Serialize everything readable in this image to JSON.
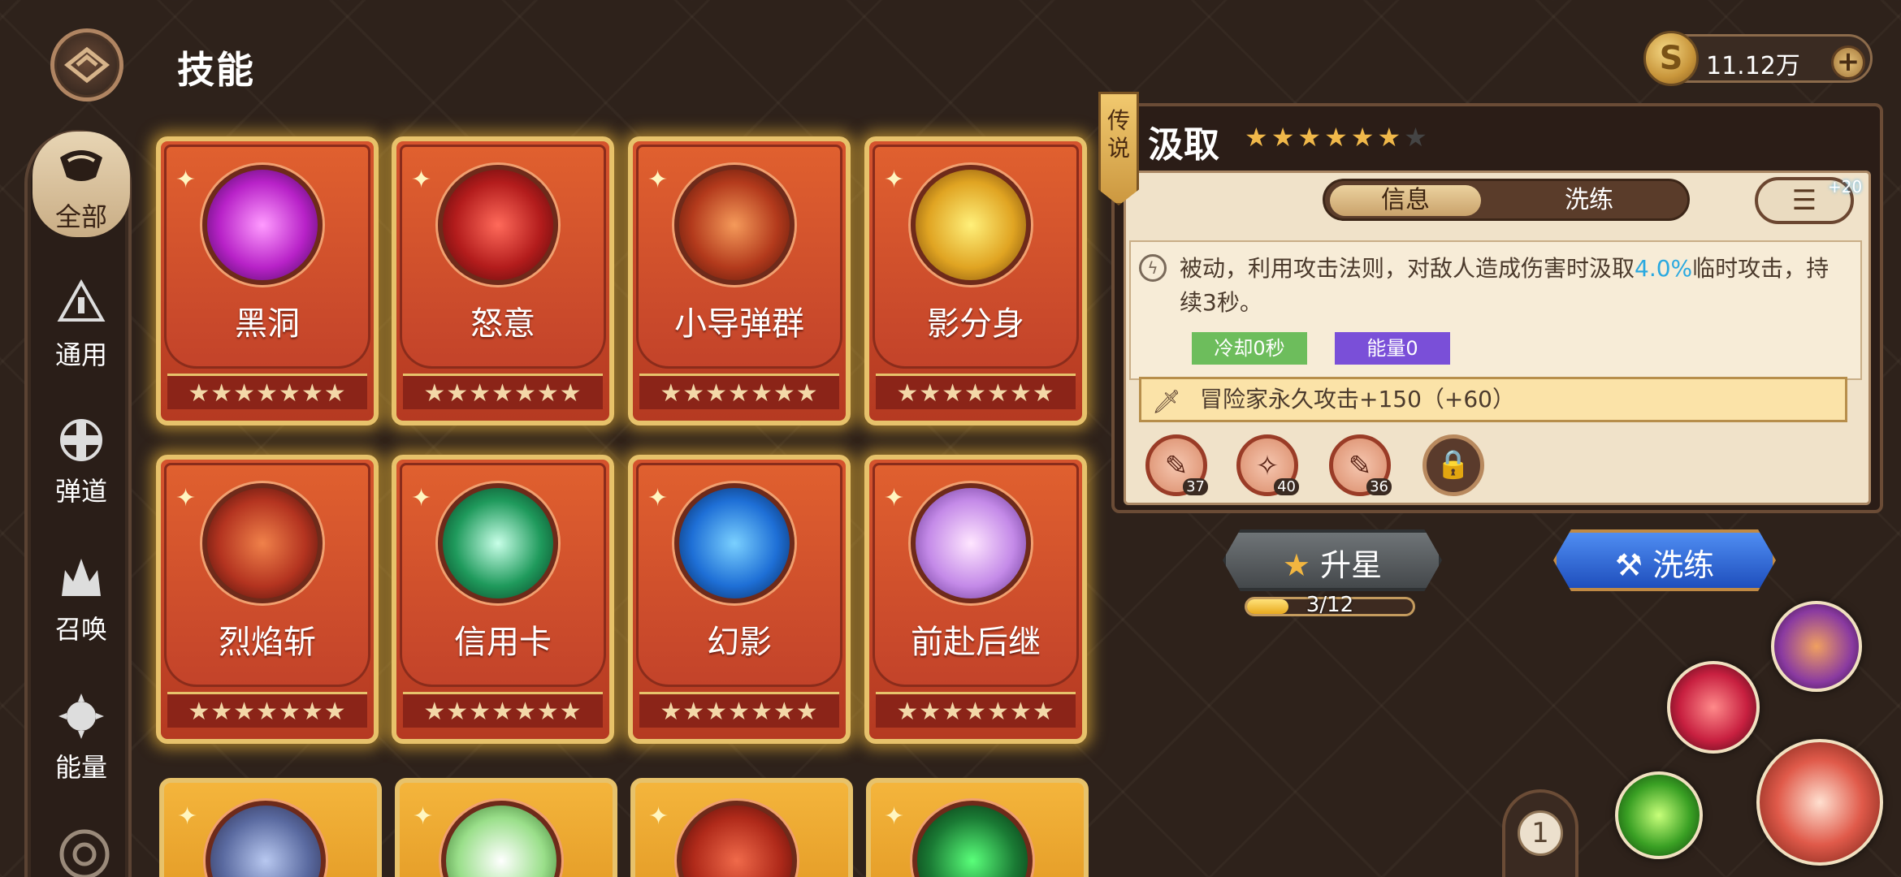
{
  "header": {
    "title": "技能",
    "currency_value": "11.12万",
    "currency_symbol": "S",
    "add_label": "+"
  },
  "sidebar": {
    "items": [
      {
        "label": "全部",
        "active": true
      },
      {
        "label": "通用"
      },
      {
        "label": "弹道"
      },
      {
        "label": "召唤"
      },
      {
        "label": "能量"
      }
    ]
  },
  "cards": [
    {
      "name": "黑洞",
      "stars": "★★★★★★★"
    },
    {
      "name": "怒意",
      "stars": "★★★★★★★"
    },
    {
      "name": "小导弹群",
      "stars": "★★★★★★★"
    },
    {
      "name": "影分身",
      "stars": "★★★★★★★"
    },
    {
      "name": "烈焰斩",
      "stars": "★★★★★★★"
    },
    {
      "name": "信用卡",
      "stars": "★★★★★★★"
    },
    {
      "name": "幻影",
      "stars": "★★★★★★★"
    },
    {
      "name": "前赴后继",
      "stars": "★★★★★★★"
    }
  ],
  "detail": {
    "rarity_tag": "传说",
    "name": "汲取",
    "stars_filled": "★★★★★★",
    "stars_empty": "★",
    "tabs": {
      "info": "信息",
      "refine": "洗练"
    },
    "list_badge": "+20",
    "desc_pre": "被动，利用攻击法则，对敌人造成伤害时汲取",
    "desc_highlight": "4.0%",
    "desc_post": "临时攻击，持续3秒。",
    "cooldown": "冷却0秒",
    "energy": "能量0",
    "bonus": "冒险家永久攻击+150（+60）",
    "sub_levels": [
      "37",
      "40",
      "36"
    ]
  },
  "actions": {
    "upstar_label": "升星",
    "progress_text": "3/12",
    "progress": {
      "current": 3,
      "max": 12
    },
    "refine_label": "洗练"
  },
  "page_indicator": "1",
  "colors": {
    "accent_gold": "#e7c26b",
    "card_red": "#c3432a",
    "highlight_blue": "#2aa9e0",
    "refine_blue": "#2f63d6"
  }
}
